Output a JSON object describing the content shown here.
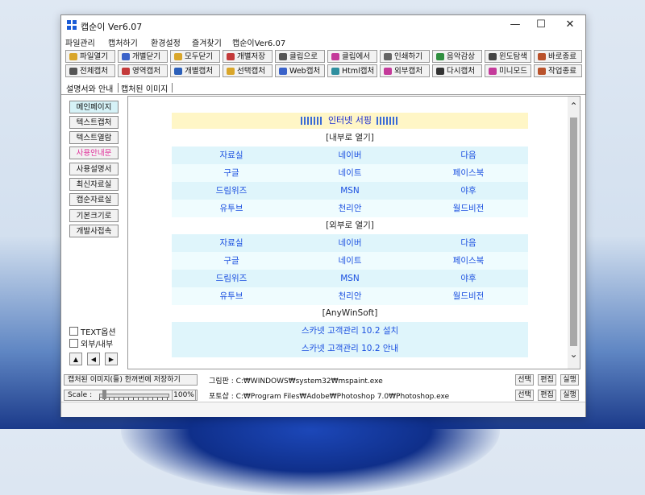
{
  "window": {
    "title": "캡순이 Ver6.07",
    "minimize_glyph": "—",
    "maximize_glyph": "☐",
    "close_glyph": "✕"
  },
  "menu": [
    "파일관리",
    "캡처하기",
    "환경설정",
    "즐겨찾기",
    "캡순이Ver6.07"
  ],
  "toolbar": {
    "row1": [
      {
        "label": "파일열기",
        "icon": "open-file-icon",
        "color": "#d9a62a"
      },
      {
        "label": "개별닫기",
        "icon": "close-single-icon",
        "color": "#3a62c9"
      },
      {
        "label": "모두닫기",
        "icon": "close-all-icon",
        "color": "#d9a62a"
      },
      {
        "label": "개별저장",
        "icon": "save-icon",
        "color": "#c43a3a"
      },
      {
        "label": "클립으로",
        "icon": "clipboard-icon",
        "color": "#555555"
      },
      {
        "label": "클립에서",
        "icon": "from-clipboard-icon",
        "color": "#c43a9a"
      },
      {
        "label": "인쇄하기",
        "icon": "print-icon",
        "color": "#666666"
      },
      {
        "label": "음악감상",
        "icon": "music-icon",
        "color": "#2f8f3f"
      },
      {
        "label": "윈도탐색",
        "icon": "explorer-icon",
        "color": "#444444"
      },
      {
        "label": "바로종료",
        "icon": "exit-icon",
        "color": "#b9522b"
      }
    ],
    "row2": [
      {
        "label": "전체캡처",
        "icon": "full-capture-icon",
        "color": "#555555"
      },
      {
        "label": "영역캡처",
        "icon": "region-capture-icon",
        "color": "#c43a3a"
      },
      {
        "label": "개별캡처",
        "icon": "window-capture-icon",
        "color": "#2b5fb9"
      },
      {
        "label": "선택캡처",
        "icon": "select-capture-icon",
        "color": "#d9a62a"
      },
      {
        "label": "Web캡처",
        "icon": "web-capture-icon",
        "color": "#3a62c9"
      },
      {
        "label": "Html캡처",
        "icon": "html-capture-icon",
        "color": "#2f8f9f"
      },
      {
        "label": "외부캡처",
        "icon": "external-capture-icon",
        "color": "#c43a9a"
      },
      {
        "label": "다시캡처",
        "icon": "recapture-icon",
        "color": "#333333"
      },
      {
        "label": "미니모드",
        "icon": "mini-mode-icon",
        "color": "#c43a9a"
      },
      {
        "label": "작업종료",
        "icon": "end-task-icon",
        "color": "#b9522b"
      }
    ]
  },
  "tabs": [
    "설명서와 안내",
    "캡처된 이미지"
  ],
  "sidebar": {
    "buttons": [
      "메인페이지",
      "텍스트캡처",
      "텍스트열람",
      "사용안내문",
      "사용설명서",
      "최신자료실",
      "캡순자료실",
      "기본크기로",
      "개발사접속"
    ],
    "active_color": "#d6f2f7",
    "highlight_color": "#e0309a",
    "checkboxes": [
      "TEXT옵션",
      "외부/내부"
    ],
    "arrows": [
      "▲",
      "◀",
      "▶"
    ]
  },
  "content": {
    "banner": "인터넷 서핑",
    "sections": [
      {
        "title": "[내부로 열기]",
        "rows": [
          [
            "자료실",
            "네이버",
            "다음"
          ],
          [
            "구글",
            "네이트",
            "페이스북"
          ],
          [
            "드림위즈",
            "MSN",
            "야후"
          ],
          [
            "유투브",
            "천리안",
            "월드비전"
          ]
        ]
      },
      {
        "title": "[외부로 열기]",
        "rows": [
          [
            "자료실",
            "네이버",
            "다음"
          ],
          [
            "구글",
            "네이트",
            "페이스북"
          ],
          [
            "드림위즈",
            "MSN",
            "야후"
          ],
          [
            "유투브",
            "천리안",
            "월드비전"
          ]
        ]
      }
    ],
    "vendor_title": "[AnyWinSoft]",
    "vendor_links": [
      "스카넷 고객관리 10.2 설치",
      "스카넷 고객관리 10.2 안내"
    ],
    "scroll_up_glyph": "⌃",
    "scroll_down_glyph": "⌄"
  },
  "status": {
    "save_all_button": "캡처된 이미지(들) 한꺼번에 저장하기",
    "paint_label": "그림판 : C:₩WINDOWS₩system32₩mspaint.exe",
    "scale_label": "Scale :",
    "zoom": "100%",
    "zoom_slider_fraction": 0.05,
    "photoshop_label": "포토샵 : C:₩Program Files₩Adobe₩Photoshop 7.0₩Photoshop.exe",
    "select_button": "선택",
    "edit_button": "편집",
    "run_button": "실행"
  }
}
